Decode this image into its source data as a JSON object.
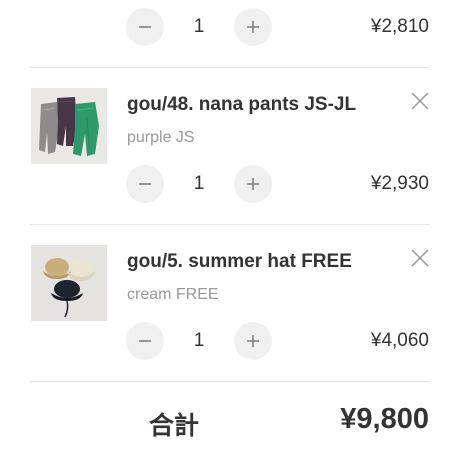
{
  "cart": {
    "items": [
      {
        "title": "",
        "variant": "",
        "quantity": "1",
        "price": "¥2,810",
        "has_header": false
      },
      {
        "title": "gou/48. nana pants JS-JL",
        "variant": "purple JS",
        "quantity": "1",
        "price": "¥2,930",
        "thumbnail_icon": "pants-photo",
        "has_header": true
      },
      {
        "title": "gou/5. summer hat FREE",
        "variant": "cream FREE",
        "quantity": "1",
        "price": "¥4,060",
        "thumbnail_icon": "hat-photo",
        "has_header": true
      }
    ],
    "total_label": "合計",
    "total_value": "¥9,800"
  },
  "colors": {
    "text": "#333333",
    "muted": "#999999",
    "button_bg": "#f0f0f0",
    "divider": "#e6e6e6"
  }
}
